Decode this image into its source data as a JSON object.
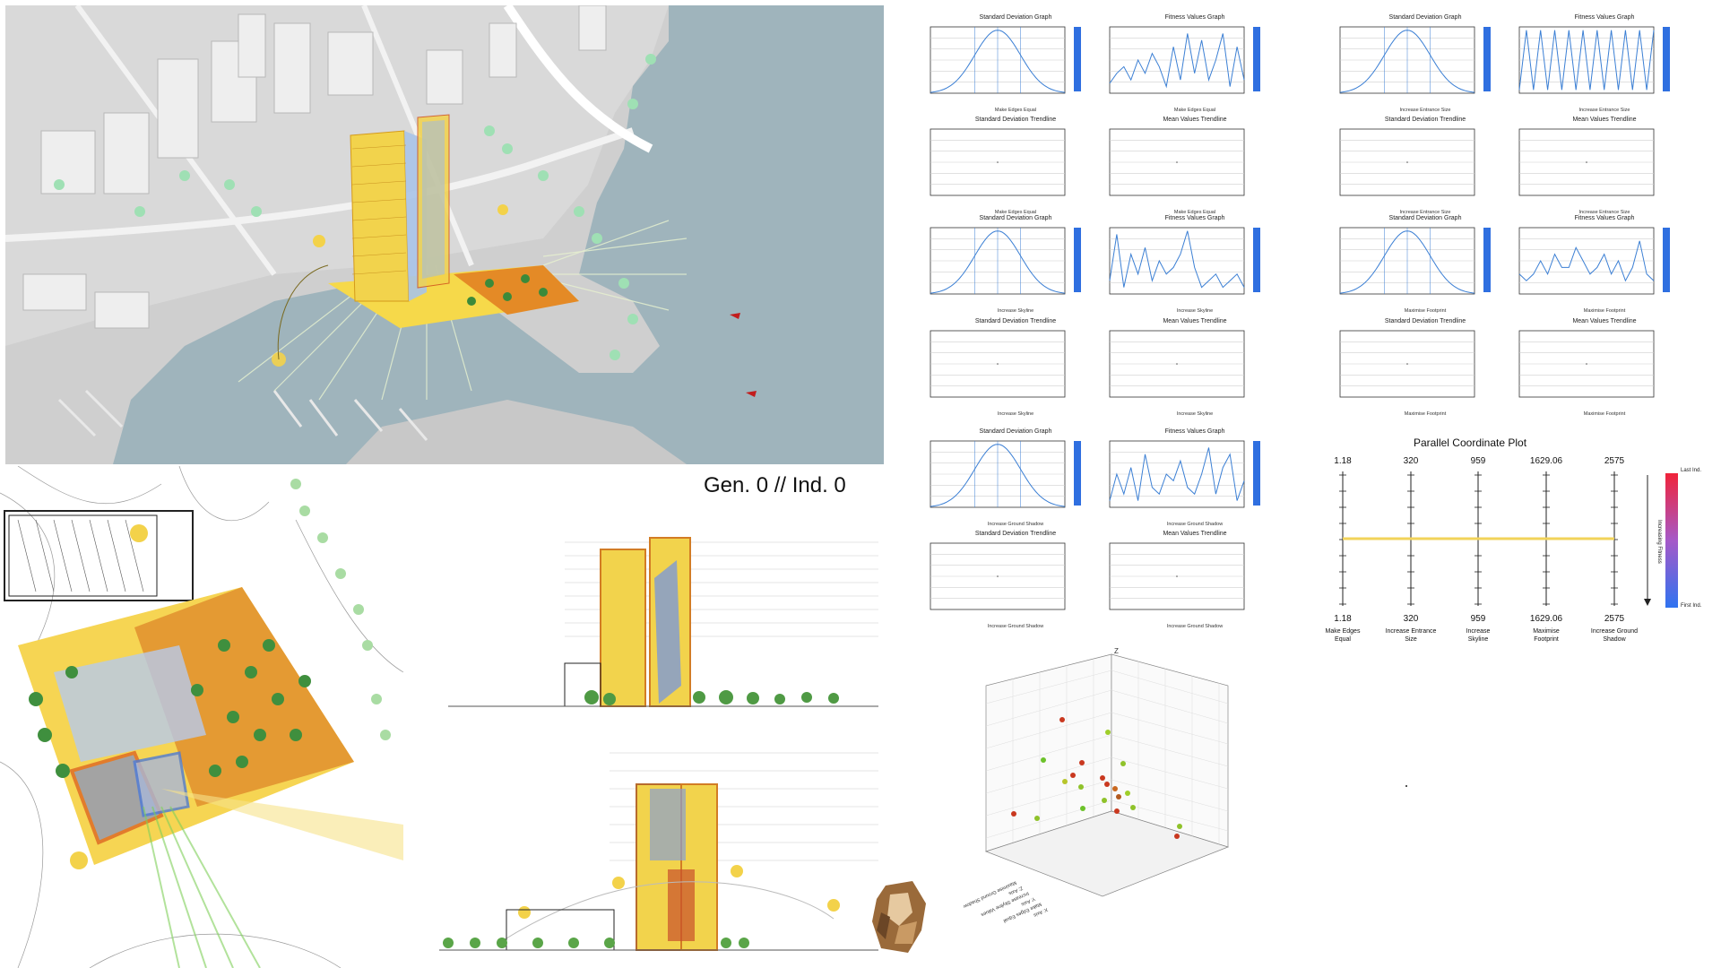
{
  "generation_label": "Gen. 0 // Ind. 0",
  "fitness_tiles": [
    {
      "title": "Standard Deviation Graph",
      "subtitle": "Make Edges Equal",
      "kind": "bell"
    },
    {
      "title": "Fitness Values Graph",
      "subtitle": "Make Edges Equal",
      "kind": "line1"
    },
    {
      "title": "Standard Deviation Graph",
      "subtitle": "Increase Entrance Size",
      "kind": "bell"
    },
    {
      "title": "Fitness Values Graph",
      "subtitle": "Increase Entrance Size",
      "kind": "zig"
    },
    {
      "title": "Standard Deviation Trendline",
      "subtitle": "Make Edges Equal",
      "kind": "trend"
    },
    {
      "title": "Mean Values Trendline",
      "subtitle": "Make Edges Equal",
      "kind": "trend"
    },
    {
      "title": "Standard Deviation Trendline",
      "subtitle": "Increase Entrance Size",
      "kind": "trend"
    },
    {
      "title": "Mean Values Trendline",
      "subtitle": "Increase Entrance Size",
      "kind": "trend"
    },
    {
      "title": "Standard Deviation Graph",
      "subtitle": "Increase Skyline",
      "kind": "bell"
    },
    {
      "title": "Fitness Values Graph",
      "subtitle": "Increase Skyline",
      "kind": "line2"
    },
    {
      "title": "Standard Deviation Graph",
      "subtitle": "Maximise Footprint",
      "kind": "bell"
    },
    {
      "title": "Fitness Values Graph",
      "subtitle": "Maximise Footprint",
      "kind": "line3"
    },
    {
      "title": "Standard Deviation Trendline",
      "subtitle": "Increase Skyline",
      "kind": "trend"
    },
    {
      "title": "Mean Values Trendline",
      "subtitle": "Increase Skyline",
      "kind": "trend"
    },
    {
      "title": "Standard Deviation Trendline",
      "subtitle": "Maximise Footprint",
      "kind": "trend"
    },
    {
      "title": "Mean Values Trendline",
      "subtitle": "Maximise Footprint",
      "kind": "trend"
    },
    {
      "title": "Standard Deviation Graph",
      "subtitle": "Increase Ground Shadow",
      "kind": "bell"
    },
    {
      "title": "Fitness Values Graph",
      "subtitle": "Increase Ground Shadow",
      "kind": "line4"
    },
    {
      "title": "Standard Deviation Trendline",
      "subtitle": "Increase Ground Shadow",
      "kind": "trend"
    },
    {
      "title": "Mean Values Trendline",
      "subtitle": "Increase Ground Shadow",
      "kind": "trend"
    }
  ],
  "parallel_plot": {
    "title": "Parallel Coordinate Plot",
    "axes": [
      {
        "top": "1.18",
        "bottom": "1.18",
        "label1": "Make Edges",
        "label2": "Equal"
      },
      {
        "top": "320",
        "bottom": "320",
        "label1": "Increase Entrance",
        "label2": "Size"
      },
      {
        "top": "959",
        "bottom": "959",
        "label1": "Increase",
        "label2": "Skyline"
      },
      {
        "top": "1629.06",
        "bottom": "1629.06",
        "label1": "Maximise",
        "label2": "Footprint"
      },
      {
        "top": "2575",
        "bottom": "2575",
        "label1": "Increase Ground",
        "label2": "Shadow"
      }
    ],
    "legend_top": "Last Ind.",
    "legend_bottom": "First Ind.",
    "legend_axis": "Increasing Fitness",
    "line_color": "#f2d35a"
  },
  "scatter3d": {
    "z_label": "Z",
    "axis_text": [
      "X: Axis",
      "Make Edges Equal",
      "Y: Axis",
      "Increase Skyline Values",
      "Z: Axis",
      "Maximise Ground Shadow"
    ]
  },
  "colors": {
    "accent_blue": "#2f6fe0",
    "bell_line": "#3b7fd4",
    "sea": "#9fb4bc",
    "building_yellow": "#f3d24a",
    "building_orange": "#e08a2a"
  }
}
